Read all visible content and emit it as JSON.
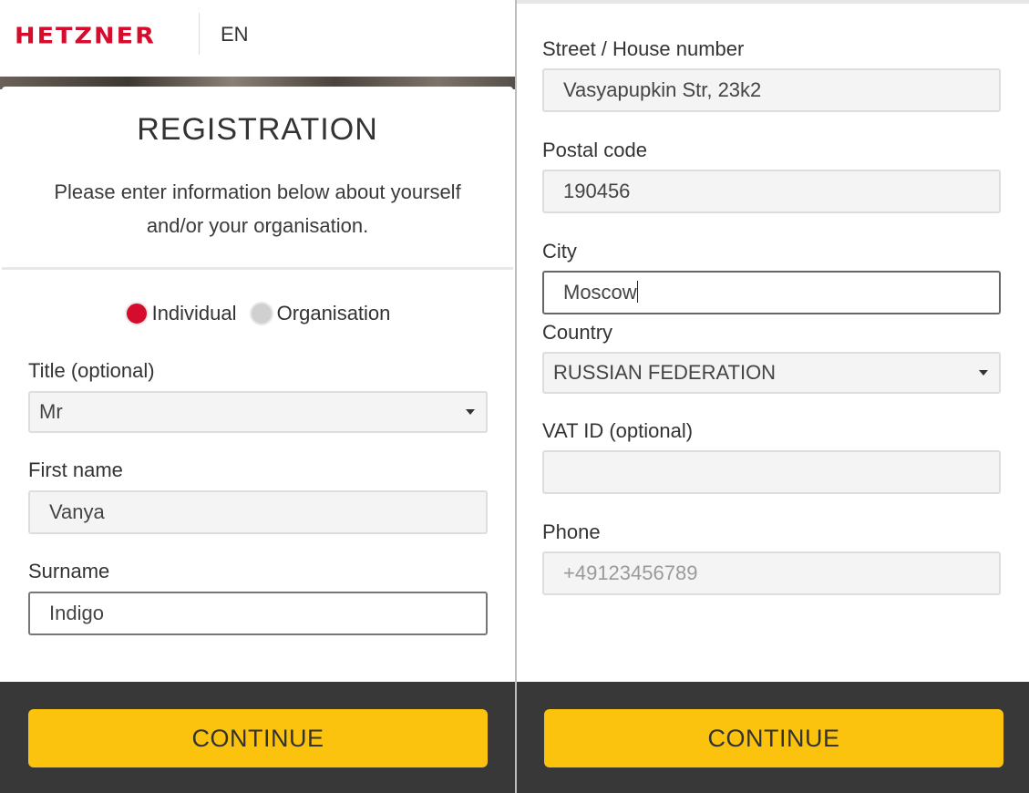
{
  "header": {
    "logo_text": "HETZNER",
    "language": "EN"
  },
  "registration": {
    "title": "REGISTRATION",
    "subtitle_line1": "Please enter information below about yourself",
    "subtitle_line2": "and/or your organisation."
  },
  "account_type": {
    "options": [
      {
        "label": "Individual",
        "selected": true
      },
      {
        "label": "Organisation",
        "selected": false
      }
    ]
  },
  "left_form": {
    "title_label": "Title (optional)",
    "title_value": "Mr",
    "first_name_label": "First name",
    "first_name_value": "Vanya",
    "surname_label": "Surname",
    "surname_value": "Indigo"
  },
  "right_form": {
    "street_label": "Street / House number",
    "street_value": "Vasyapupkin Str, 23k2",
    "postal_label": "Postal code",
    "postal_value": "190456",
    "city_label": "City",
    "city_value": "Moscow",
    "country_label": "Country",
    "country_value": "RUSSIAN FEDERATION",
    "vat_label": "VAT ID (optional)",
    "vat_value": "",
    "phone_label": "Phone",
    "phone_placeholder": "+49123456789"
  },
  "footer": {
    "continue_label": "CONTINUE"
  },
  "colors": {
    "brand_red": "#d50c2d",
    "button_yellow": "#fbc30d",
    "footer_dark": "#383838"
  }
}
